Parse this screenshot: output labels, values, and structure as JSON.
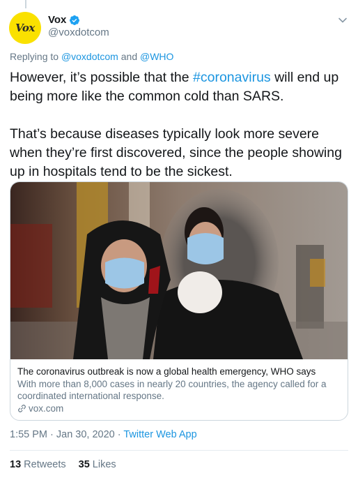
{
  "author": {
    "avatar_text": "Vox",
    "display_name": "Vox",
    "handle": "@voxdotcom",
    "verified": true
  },
  "reply_to": {
    "prefix": "Replying to",
    "user1": "@voxdotcom",
    "conjunction": "and",
    "user2": "@WHO"
  },
  "tweet": {
    "p1_before": "However, it’s possible that the ",
    "hashtag": "#coronavirus",
    "p1_after": " will end up being more like the common cold than SARS.",
    "p2": "That’s because diseases typically look more severe when they’re first discovered, since the people showing up in hospitals tend to be the sickest."
  },
  "card": {
    "image_icon": "photo-two-women-in-masks",
    "title": "The coronavirus outbreak is now a global health emergency, WHO says",
    "description": "With more than 8,000 cases in nearly 20 countries, the agency called for a coordinated international response.",
    "domain": "vox.com",
    "domain_icon": "link-icon"
  },
  "meta": {
    "time": "1:55 PM",
    "sep1": " · ",
    "date": "Jan 30, 2020",
    "sep2": " · ",
    "app": "Twitter Web App"
  },
  "stats": {
    "retweets_count": "13",
    "retweets_label": "Retweets",
    "likes_count": "35",
    "likes_label": "Likes"
  },
  "colors": {
    "link": "#1b95e0",
    "secondary": "#657786",
    "brand": "#fae100"
  }
}
